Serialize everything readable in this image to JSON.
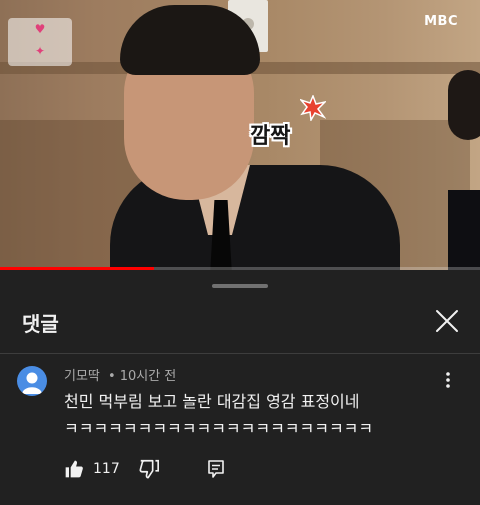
{
  "video": {
    "channel_watermark": "MBC",
    "caption": "깜짝",
    "progress_fraction": 0.32
  },
  "sheet": {
    "title": "댓글"
  },
  "comment": {
    "author": "기모딱",
    "separator": "•",
    "time": "10시간 전",
    "text_line1": "천민 먹부림 보고 놀란 대감집 영감 표정이네",
    "text_line2": "ㅋㅋㅋㅋㅋㅋㅋㅋㅋㅋㅋㅋㅋㅋㅋㅋㅋㅋㅋㅋㅋ",
    "like_count": "117"
  },
  "icons": [
    "close-icon",
    "more-vert-icon",
    "thumb-up-icon",
    "thumb-down-icon",
    "reply-icon",
    "default-avatar-icon"
  ],
  "colors": {
    "background": "#212121",
    "text_primary": "#f1f1f1",
    "text_secondary": "#aaaaaa",
    "progress": "#ff0000",
    "avatar": "#4a8de4"
  }
}
